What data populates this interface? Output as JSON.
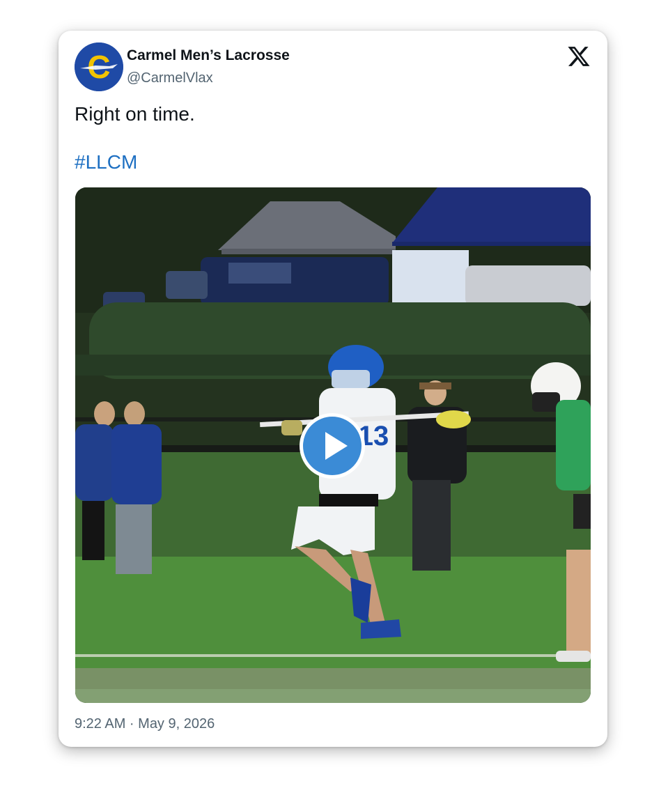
{
  "author": {
    "display_name": "Carmel Men’s Lacrosse",
    "handle": "@CarmelVlax",
    "avatar_letter": "C"
  },
  "tweet": {
    "text": "Right on time.",
    "hashtag": "#LLCM",
    "timestamp": "9:22 AM · May 9, 2026"
  },
  "media": {
    "type": "video",
    "player_number": "13",
    "play_icon": "play-icon"
  },
  "icons": {
    "platform": "x-logo-icon"
  },
  "colors": {
    "hashtag": "#1d6fc2",
    "avatar_bg": "#1f4aa6",
    "avatar_letter": "#f2c300",
    "play_button": "#3b8bd6",
    "secondary_text": "#536471"
  }
}
